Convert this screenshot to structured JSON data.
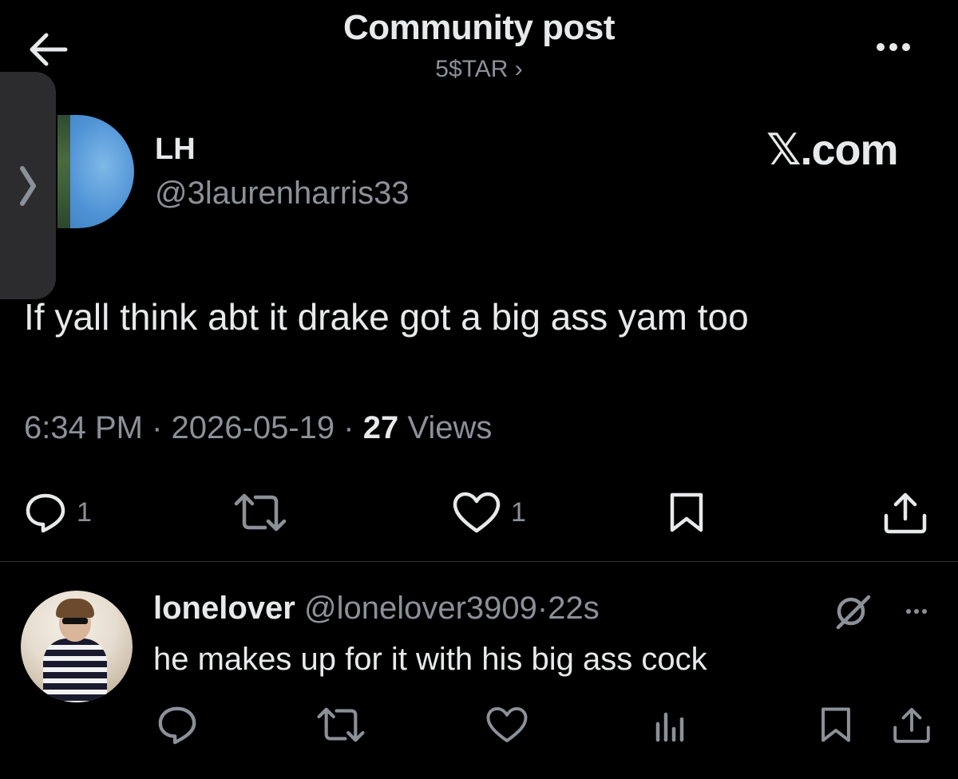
{
  "header": {
    "title": "Community post",
    "community": "5$TAR ›"
  },
  "post": {
    "author_name": "LH",
    "author_handle": "@3laurenharris33",
    "watermark": "𝕏.com",
    "text": "If yall think abt it drake got a big ass yam too",
    "time": "6:34 PM",
    "date": "2026-05-19",
    "views_count": "27",
    "views_label": "Views",
    "replies_count": "1",
    "likes_count": "1",
    "separator": "·"
  },
  "reply": {
    "name": "lonelover",
    "handle": "@lonelover3909",
    "time": "22s",
    "separator": "·",
    "text": "he makes up for it with his big ass cock"
  },
  "icons": {
    "back": "arrow-left-icon",
    "more": "more-horizontal-icon",
    "side_handle": "chevron-right-icon",
    "reply": "speech-bubble-icon",
    "repost": "repost-icon",
    "like": "heart-icon",
    "bookmark": "bookmark-icon",
    "share": "share-icon",
    "views": "bar-chart-icon",
    "grok": "grok-icon"
  },
  "colors": {
    "background": "#000000",
    "text_primary": "#e7e9ea",
    "text_secondary": "#8b9199",
    "divider": "#2f3336",
    "side_handle": "#2c2c2e"
  }
}
